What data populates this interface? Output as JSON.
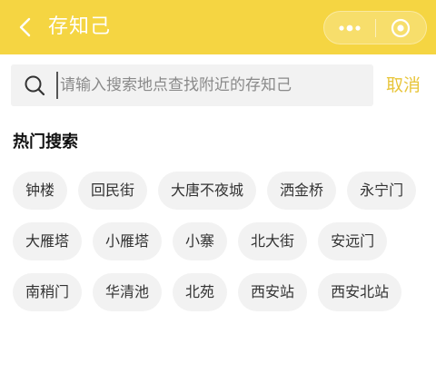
{
  "navbar": {
    "title": "存知己",
    "back_icon": "chevron-left-icon",
    "menu_icon": "more-dots-icon",
    "close_icon": "target-circle-icon",
    "background_color": "#f5d542"
  },
  "search": {
    "placeholder": "请输入搜索地点查找附近的存知己",
    "value": "",
    "cancel_label": "取消",
    "accent_color": "#e8c53a"
  },
  "hot": {
    "title": "热门搜索",
    "tags": [
      "钟楼",
      "回民街",
      "大唐不夜城",
      "洒金桥",
      "永宁门",
      "大雁塔",
      "小雁塔",
      "小寨",
      "北大街",
      "安远门",
      "南稍门",
      "华清池",
      "北苑",
      "西安站",
      "西安北站"
    ]
  }
}
